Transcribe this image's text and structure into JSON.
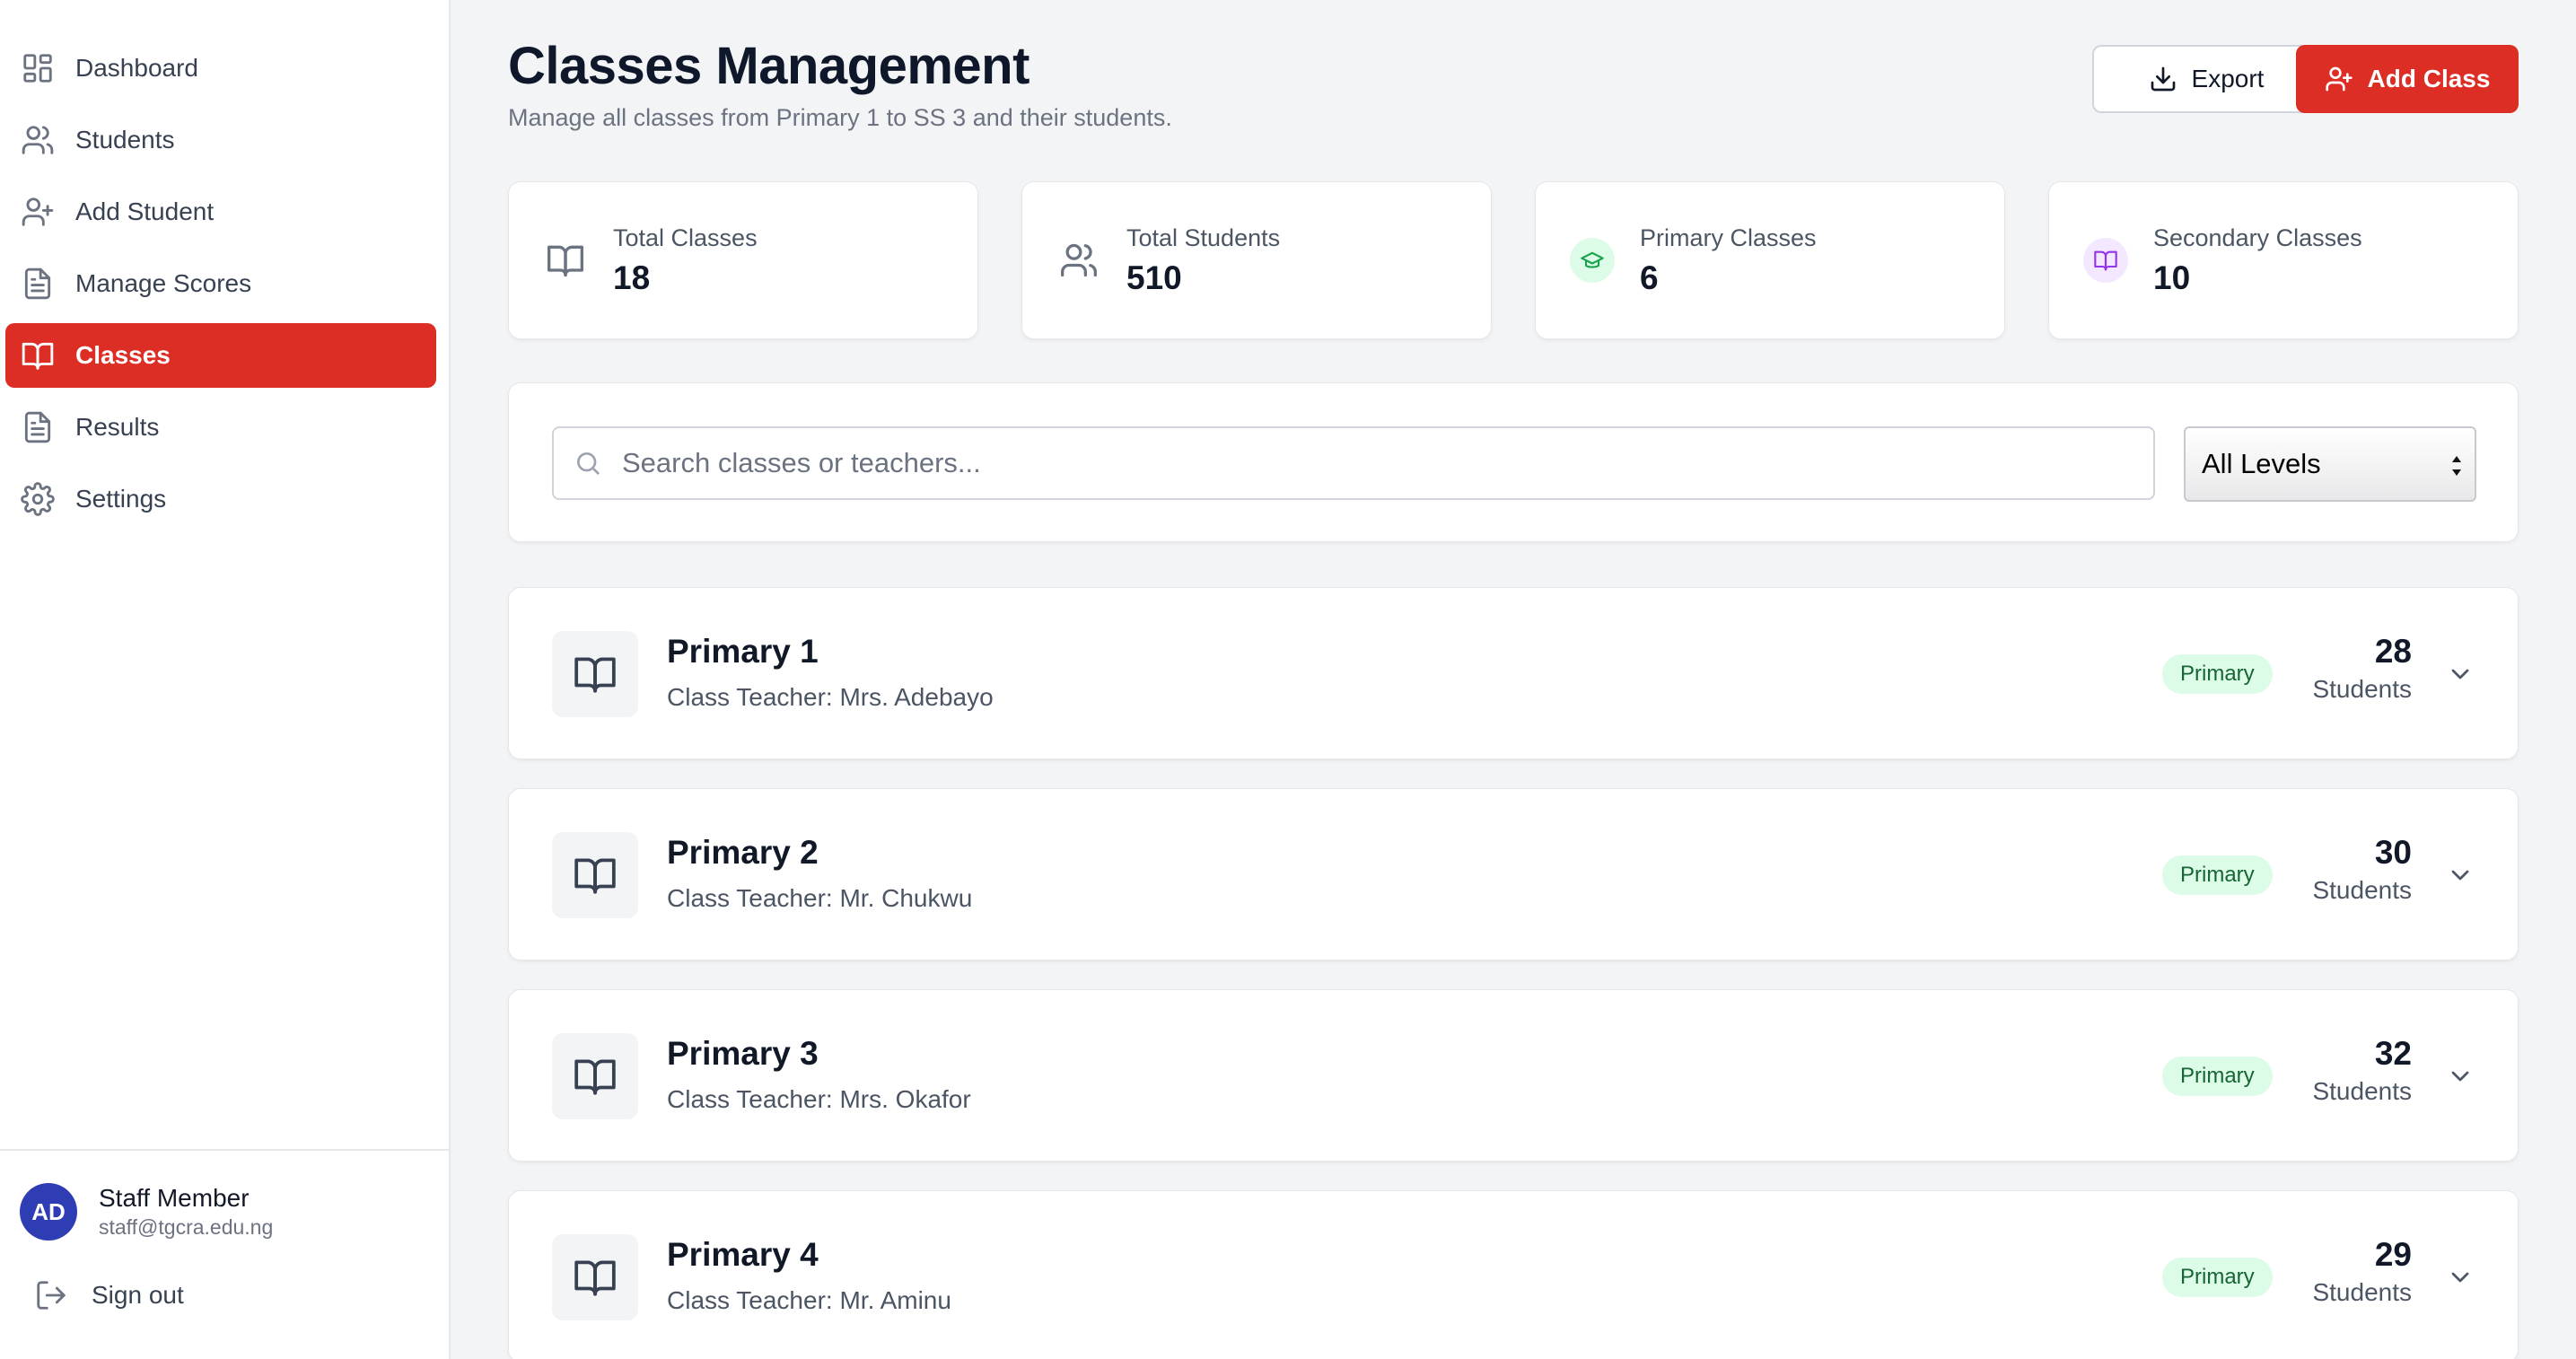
{
  "sidebar": {
    "items": [
      {
        "label": "Dashboard",
        "icon": "dashboard-icon",
        "active": false
      },
      {
        "label": "Students",
        "icon": "users-icon",
        "active": false
      },
      {
        "label": "Add Student",
        "icon": "user-plus-icon",
        "active": false
      },
      {
        "label": "Manage Scores",
        "icon": "document-icon",
        "active": false
      },
      {
        "label": "Classes",
        "icon": "book-open-icon",
        "active": true
      },
      {
        "label": "Results",
        "icon": "document-icon",
        "active": false
      },
      {
        "label": "Settings",
        "icon": "gear-icon",
        "active": false
      }
    ],
    "user": {
      "initials": "AD",
      "name": "Staff Member",
      "email": "staff@tgcra.edu.ng"
    },
    "signout_label": "Sign out"
  },
  "header": {
    "title": "Classes Management",
    "subtitle": "Manage all classes from Primary 1 to SS 3 and their students.",
    "export_label": "Export",
    "add_label": "Add Class"
  },
  "stats": [
    {
      "label": "Total Classes",
      "value": "18",
      "icon": "book-open-icon"
    },
    {
      "label": "Total Students",
      "value": "510",
      "icon": "users-icon"
    },
    {
      "label": "Primary Classes",
      "value": "6",
      "icon": "graduation-cap-icon"
    },
    {
      "label": "Secondary Classes",
      "value": "10",
      "icon": "book-open-icon"
    }
  ],
  "filters": {
    "search_placeholder": "Search classes or teachers...",
    "level_selected": "All Levels"
  },
  "classes": [
    {
      "name": "Primary 1",
      "teacher": "Class Teacher: Mrs. Adebayo",
      "level": "Primary",
      "count": "28",
      "count_label": "Students"
    },
    {
      "name": "Primary 2",
      "teacher": "Class Teacher: Mr. Chukwu",
      "level": "Primary",
      "count": "30",
      "count_label": "Students"
    },
    {
      "name": "Primary 3",
      "teacher": "Class Teacher: Mrs. Okafor",
      "level": "Primary",
      "count": "32",
      "count_label": "Students"
    },
    {
      "name": "Primary 4",
      "teacher": "Class Teacher: Mr. Aminu",
      "level": "Primary",
      "count": "29",
      "count_label": "Students"
    }
  ],
  "colors": {
    "accent": "#dc2e24",
    "avatar": "#2f3db4",
    "primary_badge_bg": "#dcfce7",
    "primary_badge_text": "#166534",
    "primary_icon": "#16a34a",
    "secondary_icon": "#9333ea"
  }
}
